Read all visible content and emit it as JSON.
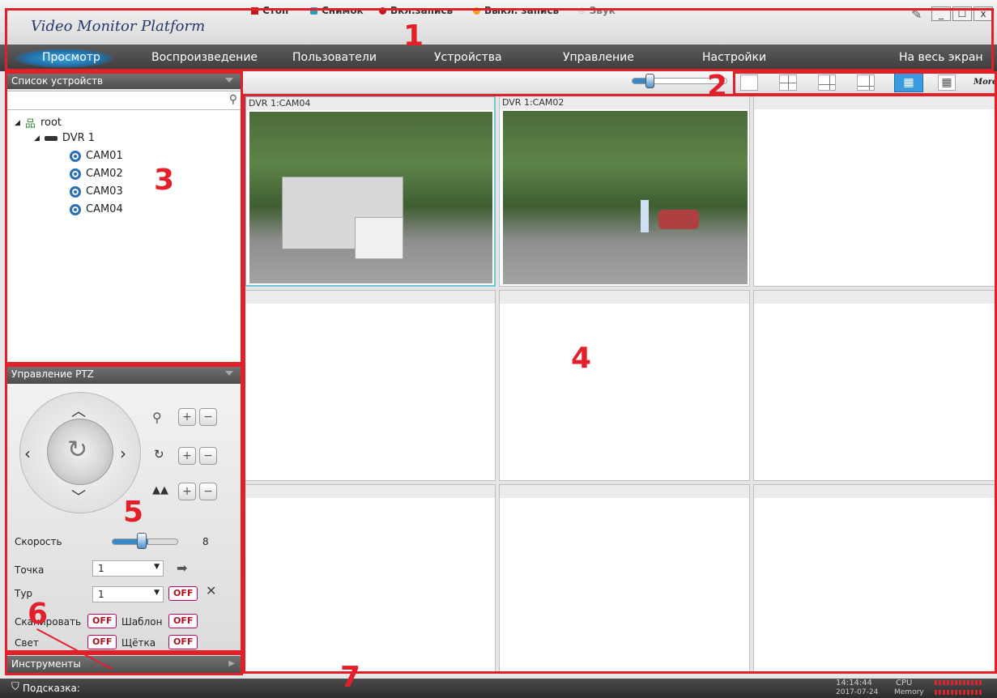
{
  "window": {
    "title": "Video Monitor Platform",
    "controls": [
      "_",
      "☐",
      "x"
    ]
  },
  "menu": {
    "items": [
      "Просмотр",
      "Воспроизведение",
      "Пользователи",
      "Устройства",
      "Управление",
      "Настройки"
    ],
    "fullscreen": "На весь экран"
  },
  "devices": {
    "header": "Список устройств",
    "tree": {
      "root": "root",
      "dvr": "DVR 1",
      "cameras": [
        "CAM01",
        "CAM02",
        "CAM03",
        "CAM04"
      ]
    }
  },
  "toolbar": {
    "stop": "Стоп",
    "snapshot": "Снимок",
    "rec_on": "Вкл.запись",
    "rec_off": "Выкл. запись",
    "sound": "Звук",
    "more": "More"
  },
  "grid": {
    "cell1": "DVR 1:CAM04",
    "cell2": "DVR 1:CAM02"
  },
  "ptz": {
    "header": "Управление PTZ",
    "speed_label": "Скорость",
    "speed_value": "8",
    "point_label": "Точка",
    "point_value": "1",
    "tour_label": "Тур",
    "tour_value": "1",
    "off": "OFF",
    "scan_label": "Сканировать",
    "template_label": "Шаблон",
    "light_label": "Свет",
    "brush_label": "Щётка"
  },
  "tools": {
    "header": "Инструменты"
  },
  "status": {
    "hint_label": "Подсказка:",
    "time": "14:14:44",
    "date": "2017-07-24",
    "cpu_label": "CPU",
    "memory_label": "Memory"
  },
  "annotations": [
    "1",
    "2",
    "3",
    "4",
    "5",
    "6",
    "7"
  ],
  "colors": {
    "annotation": "#e3202a",
    "accent": "#1f6fa8"
  }
}
